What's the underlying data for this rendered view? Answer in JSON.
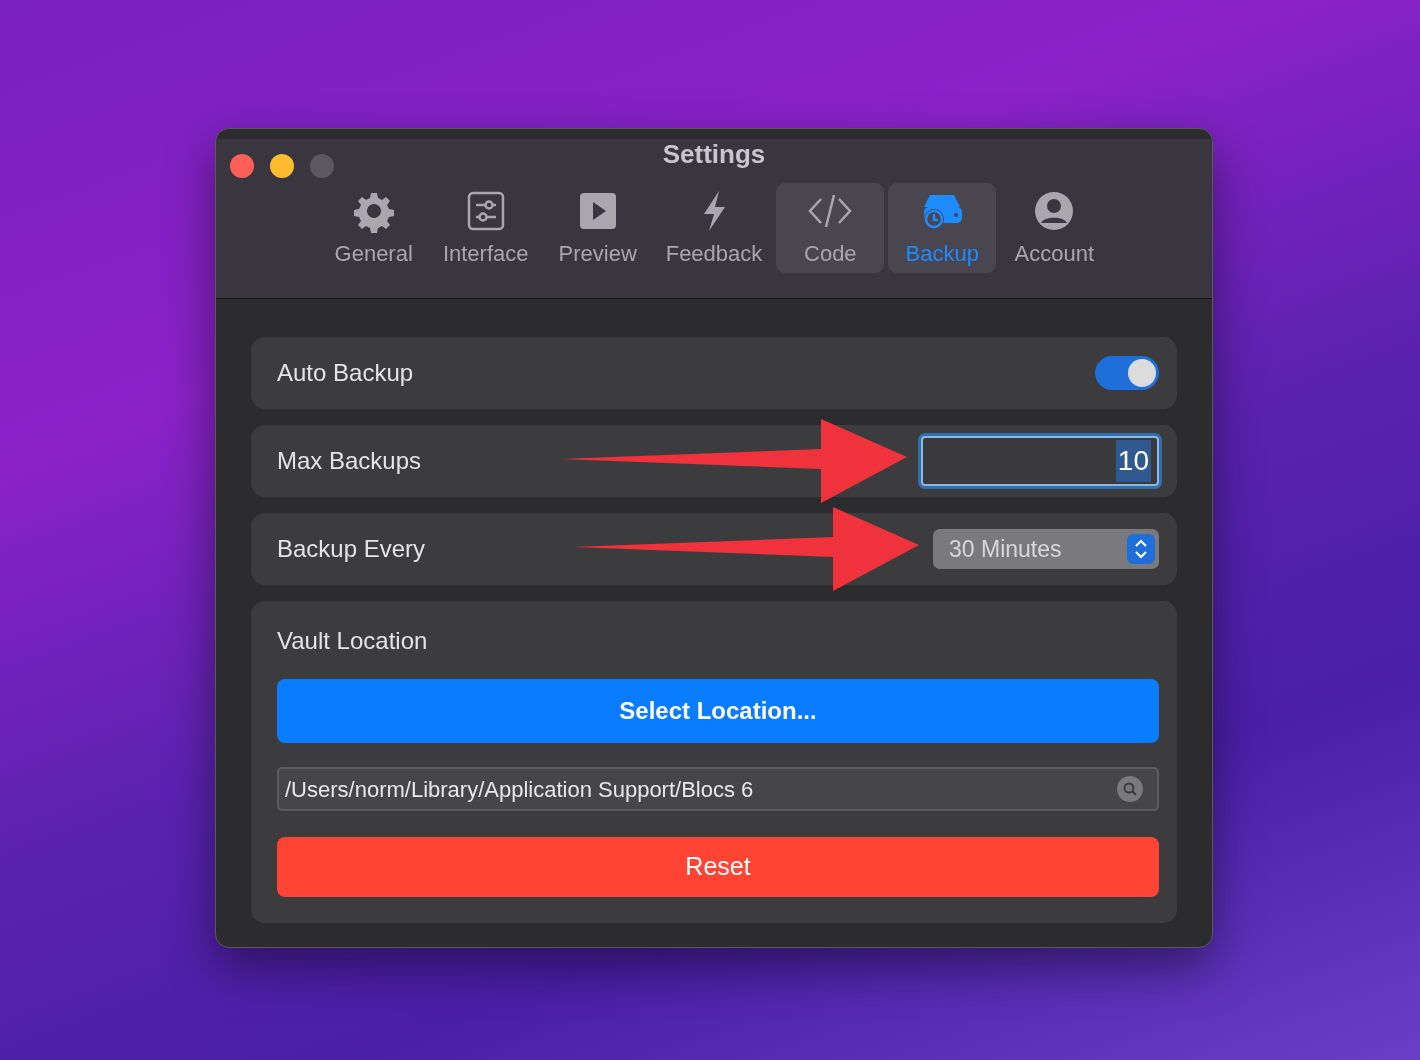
{
  "window": {
    "title": "Settings"
  },
  "tabs": [
    {
      "label": "General",
      "kind": "gear",
      "selected": false,
      "hovered": false
    },
    {
      "label": "Interface",
      "kind": "sliders",
      "selected": false,
      "hovered": false
    },
    {
      "label": "Preview",
      "kind": "play",
      "selected": false,
      "hovered": false
    },
    {
      "label": "Feedback",
      "kind": "bolt",
      "selected": false,
      "hovered": false
    },
    {
      "label": "Code",
      "kind": "code",
      "selected": false,
      "hovered": true
    },
    {
      "label": "Backup",
      "kind": "backup",
      "selected": true,
      "hovered": false
    },
    {
      "label": "Account",
      "kind": "person",
      "selected": false,
      "hovered": false
    }
  ],
  "settings": [
    {
      "kind": "toggle",
      "label": "Auto Backup",
      "on": true,
      "annotated": false
    },
    {
      "kind": "number",
      "label": "Max Backups",
      "value": "10",
      "focused": true,
      "annotated": true
    },
    {
      "kind": "select",
      "label": "Backup Every",
      "value": "30 Minutes",
      "annotated": true
    }
  ],
  "vault": {
    "label": "Vault Location",
    "select_button": "Select Location...",
    "path": "/Users/norm/Library/Application Support/Blocs 6",
    "reset_button": "Reset"
  }
}
